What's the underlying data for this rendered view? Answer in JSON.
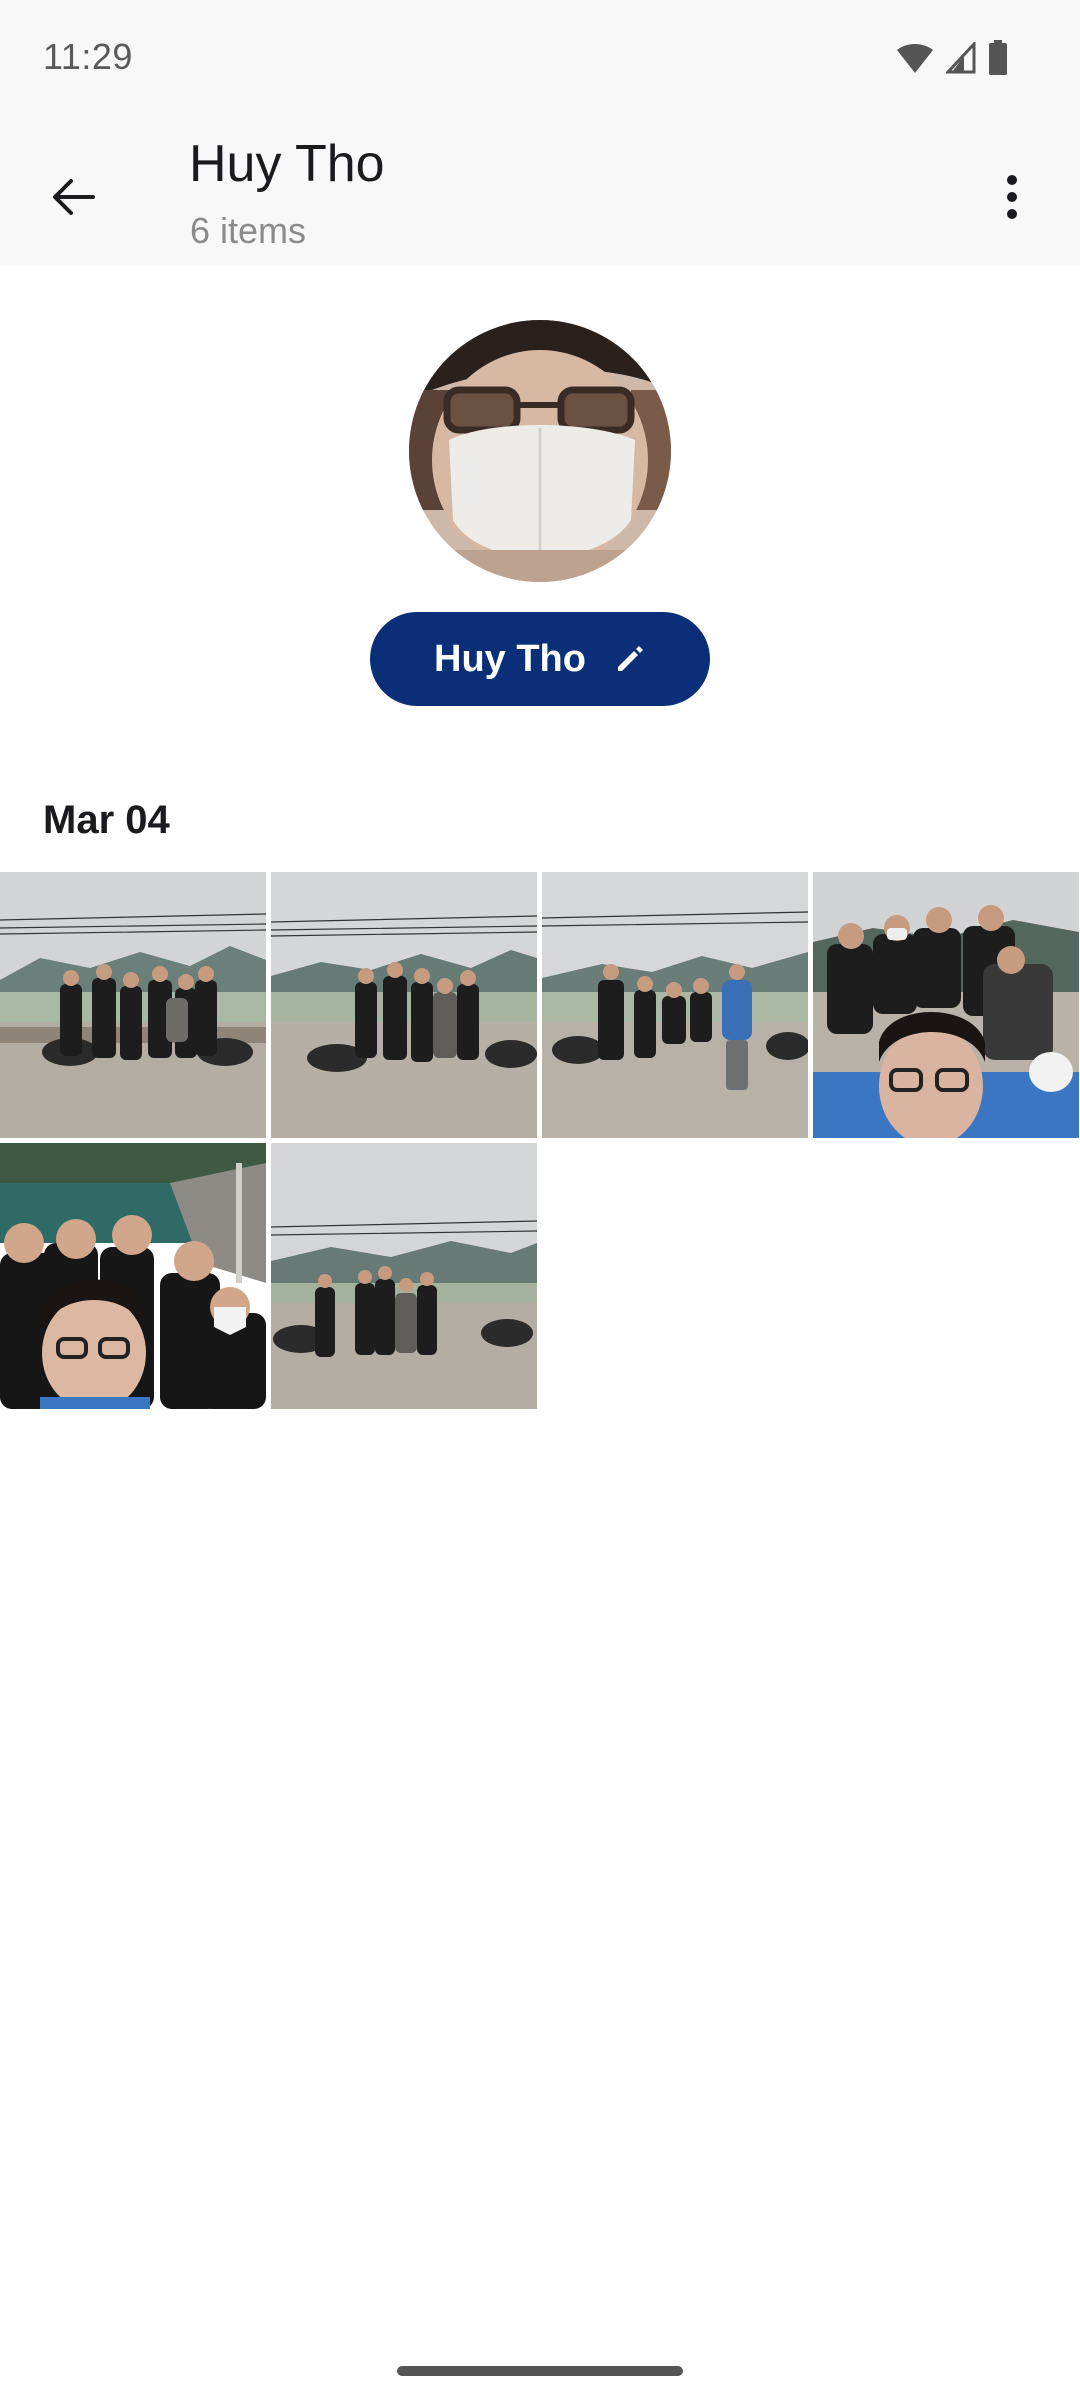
{
  "status_bar": {
    "time": "11:29",
    "icons": [
      "wifi-icon",
      "cell-signal-icon",
      "battery-icon"
    ]
  },
  "app_bar": {
    "back_icon": "arrow-back-icon",
    "title": "Huy Tho",
    "subtitle": "6 items",
    "menu_icon": "more-vert-icon"
  },
  "profile": {
    "name": "Huy Tho",
    "edit_icon": "pencil-icon",
    "chip_color": "#0a2f78"
  },
  "section": {
    "date_label": "Mar 04"
  },
  "photos": [
    {
      "kind": "group-photo-motorbikes"
    },
    {
      "kind": "group-photo-motorbikes"
    },
    {
      "kind": "group-photo-blue-jacket"
    },
    {
      "kind": "group-selfie"
    },
    {
      "kind": "group-selfie-lake"
    },
    {
      "kind": "group-photo-motorbikes"
    }
  ]
}
